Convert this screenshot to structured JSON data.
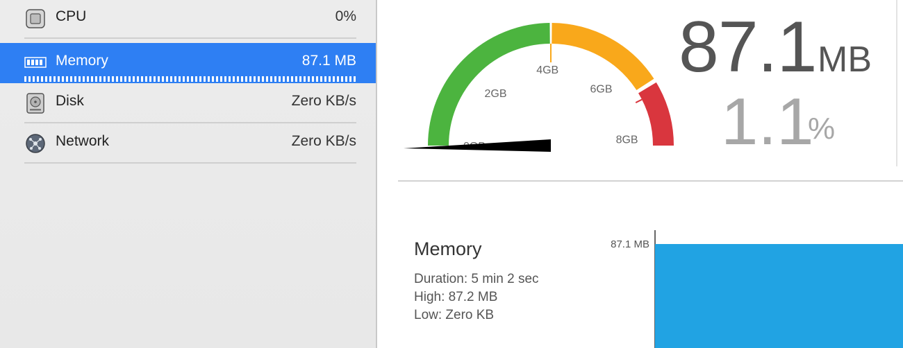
{
  "sidebar": {
    "items": [
      {
        "label": "CPU",
        "value": "0%",
        "icon": "cpu-chip-icon",
        "selected": false
      },
      {
        "label": "Memory",
        "value": "87.1 MB",
        "icon": "memory-module-icon",
        "selected": true
      },
      {
        "label": "Disk",
        "value": "Zero KB/s",
        "icon": "hard-disk-icon",
        "selected": false
      },
      {
        "label": "Network",
        "value": "Zero KB/s",
        "icon": "network-globe-icon",
        "selected": false
      }
    ]
  },
  "gauge": {
    "tick_labels": [
      "0GB",
      "2GB",
      "4GB",
      "6GB",
      "8GB"
    ],
    "max_gb": 8,
    "needle_fraction": 0.011,
    "colors": {
      "green": "#4cb43f",
      "orange": "#f9a81b",
      "red": "#d9363e",
      "needle": "#000000"
    }
  },
  "readout": {
    "value": "87.1",
    "unit": "MB",
    "percent": "1.1",
    "percent_unit": "%"
  },
  "stats": {
    "title": "Memory",
    "duration": "Duration: 5 min 2 sec",
    "high": "High: 87.2 MB",
    "low": "Low: Zero KB"
  },
  "history_chart": {
    "top_label": "87.1 MB",
    "fill_color": "#21a3e3",
    "level_fraction": 1.0
  }
}
